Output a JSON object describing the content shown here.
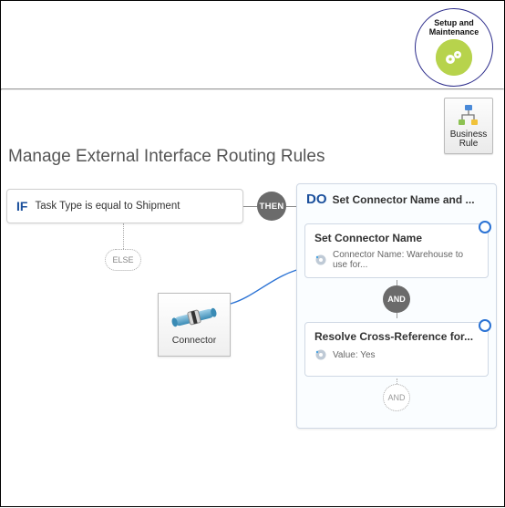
{
  "badge": {
    "line1": "Setup and",
    "line2": "Maintenance"
  },
  "toolbar": {
    "business_rule_line1": "Business",
    "business_rule_line2": "Rule"
  },
  "page_title": "Manage External Interface Routing Rules",
  "if_block": {
    "keyword": "IF",
    "condition": "Task Type is equal to Shipment"
  },
  "then_label": "THEN",
  "else_label": "ELSE",
  "connector_card": {
    "label": "Connector"
  },
  "do_block": {
    "keyword": "DO",
    "title": "Set Connector Name and ...",
    "and_label": "AND",
    "actions": [
      {
        "title": "Set Connector Name",
        "detail": "Connector Name: Warehouse to use for..."
      },
      {
        "title": "Resolve Cross-Reference for...",
        "detail": "Value: Yes"
      }
    ]
  }
}
